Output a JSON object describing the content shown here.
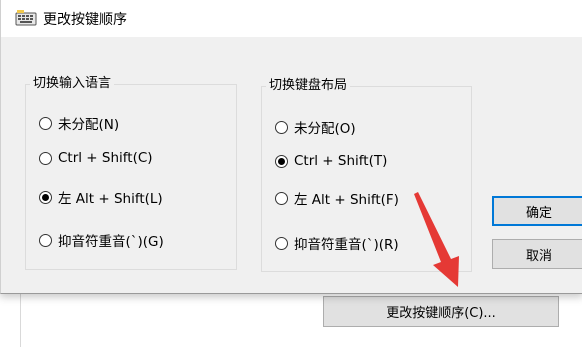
{
  "dialog": {
    "title": "更改按键顺序",
    "ok_label": "确定",
    "cancel_label": "取消"
  },
  "input_language_group": {
    "legend": "切换输入语言",
    "options": [
      {
        "label": "未分配(N)",
        "checked": false
      },
      {
        "label": "Ctrl + Shift(C)",
        "checked": false
      },
      {
        "label": "左 Alt + Shift(L)",
        "checked": true
      },
      {
        "label": "抑音符重音(`)(G)",
        "checked": false
      }
    ]
  },
  "keyboard_layout_group": {
    "legend": "切换键盘布局",
    "options": [
      {
        "label": "未分配(O)",
        "checked": false
      },
      {
        "label": "Ctrl + Shift(T)",
        "checked": true
      },
      {
        "label": "左 Alt + Shift(F)",
        "checked": false
      },
      {
        "label": "抑音符重音(`)(R)",
        "checked": false
      }
    ]
  },
  "background_window": {
    "change_key_sequence_button": "更改按键顺序(C)..."
  },
  "colors": {
    "dialog_bg": "#f0f0f0",
    "default_button_border": "#0078d7",
    "annotation_arrow": "#e53935"
  },
  "icons": {
    "title_icon": "keyboard-icon",
    "annotation": "red-arrow-icon"
  }
}
